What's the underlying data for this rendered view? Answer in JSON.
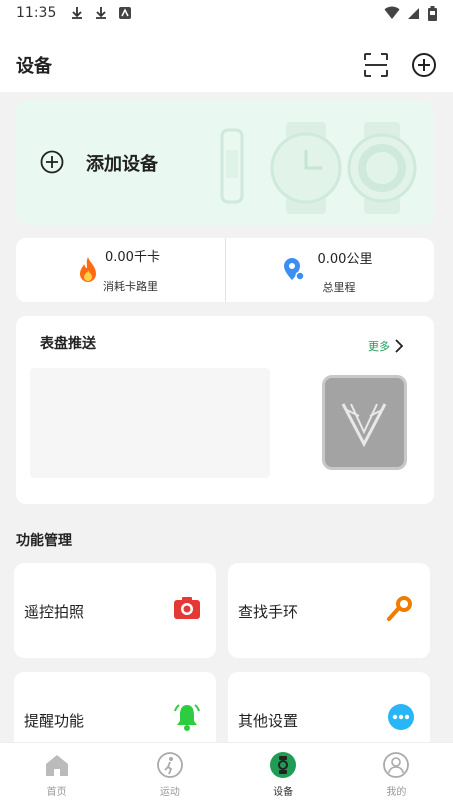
{
  "status_bar": {
    "time": "11:35"
  },
  "header": {
    "title": "设备"
  },
  "add_device": {
    "label": "添加设备"
  },
  "stats": [
    {
      "value": "0.00千卡",
      "label": "消耗卡路里"
    },
    {
      "value": "0.00公里",
      "label": "总里程"
    }
  ],
  "watchface": {
    "title": "表盘推送",
    "more": "更多"
  },
  "functions": {
    "title": "功能管理",
    "items": [
      {
        "label": "遥控拍照",
        "icon": "camera-icon",
        "color": "#e53935"
      },
      {
        "label": "查找手环",
        "icon": "search-key-icon",
        "color": "#ef7d00"
      },
      {
        "label": "提醒功能",
        "icon": "bell-icon",
        "color": "#2ecc40"
      },
      {
        "label": "其他设置",
        "icon": "more-dots-icon",
        "color": "#29b6f6"
      }
    ]
  },
  "nav": [
    {
      "label": "首页",
      "icon": "home-icon"
    },
    {
      "label": "运动",
      "icon": "run-icon"
    },
    {
      "label": "设备",
      "icon": "watch-icon",
      "active": true
    },
    {
      "label": "我的",
      "icon": "user-icon"
    }
  ],
  "colors": {
    "accent": "#1f9d55",
    "add_card_bg": "#e9f8f1",
    "content_bg": "#f2f2f2"
  }
}
